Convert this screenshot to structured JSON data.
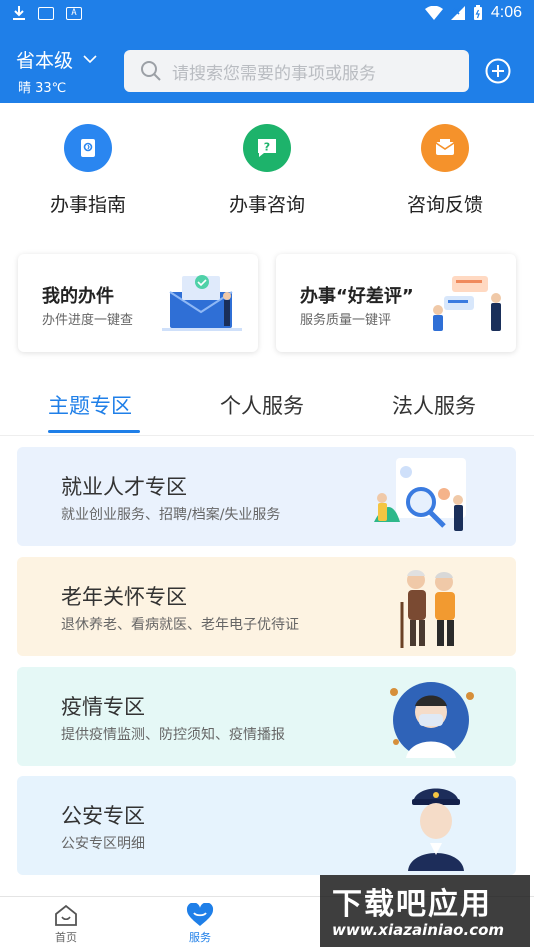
{
  "status_bar": {
    "time": "4:06"
  },
  "header": {
    "region": "省本级",
    "weather": "晴 33℃",
    "search_placeholder": "请搜索您需要的事项或服务"
  },
  "quick_actions": [
    {
      "label": "办事指南",
      "color": "#2a86f0",
      "icon": "guide-book-icon"
    },
    {
      "label": "办事咨询",
      "color": "#1db36b",
      "icon": "question-bubble-icon"
    },
    {
      "label": "咨询反馈",
      "color": "#f5922b",
      "icon": "mail-feedback-icon"
    }
  ],
  "cards": [
    {
      "title": "我的办件",
      "subtitle": "办件进度一键查"
    },
    {
      "title": "办事“好差评”",
      "subtitle": "服务质量一键评"
    }
  ],
  "tabs": [
    {
      "label": "主题专区",
      "active": true
    },
    {
      "label": "个人服务",
      "active": false
    },
    {
      "label": "法人服务",
      "active": false
    }
  ],
  "zones": [
    {
      "title": "就业人才专区",
      "subtitle": "就业创业服务、招聘/档案/失业服务",
      "bg": "#eaf2fd"
    },
    {
      "title": "老年关怀专区",
      "subtitle": "退休养老、看病就医、老年电子优待证",
      "bg": "#fdf3e2"
    },
    {
      "title": "疫情专区",
      "subtitle": "提供疫情监测、防控须知、疫情播报",
      "bg": "#e5f8f6"
    },
    {
      "title": "公安专区",
      "subtitle": "公安专区明细",
      "bg": "#e6f3fd"
    }
  ],
  "bottom_nav": [
    {
      "label": "首页",
      "active": false
    },
    {
      "label": "服务",
      "active": true
    }
  ],
  "watermark": {
    "title": "下载吧应用",
    "url": "www.xiazainiao.com"
  },
  "colors": {
    "brand": "#1f7fe8"
  }
}
